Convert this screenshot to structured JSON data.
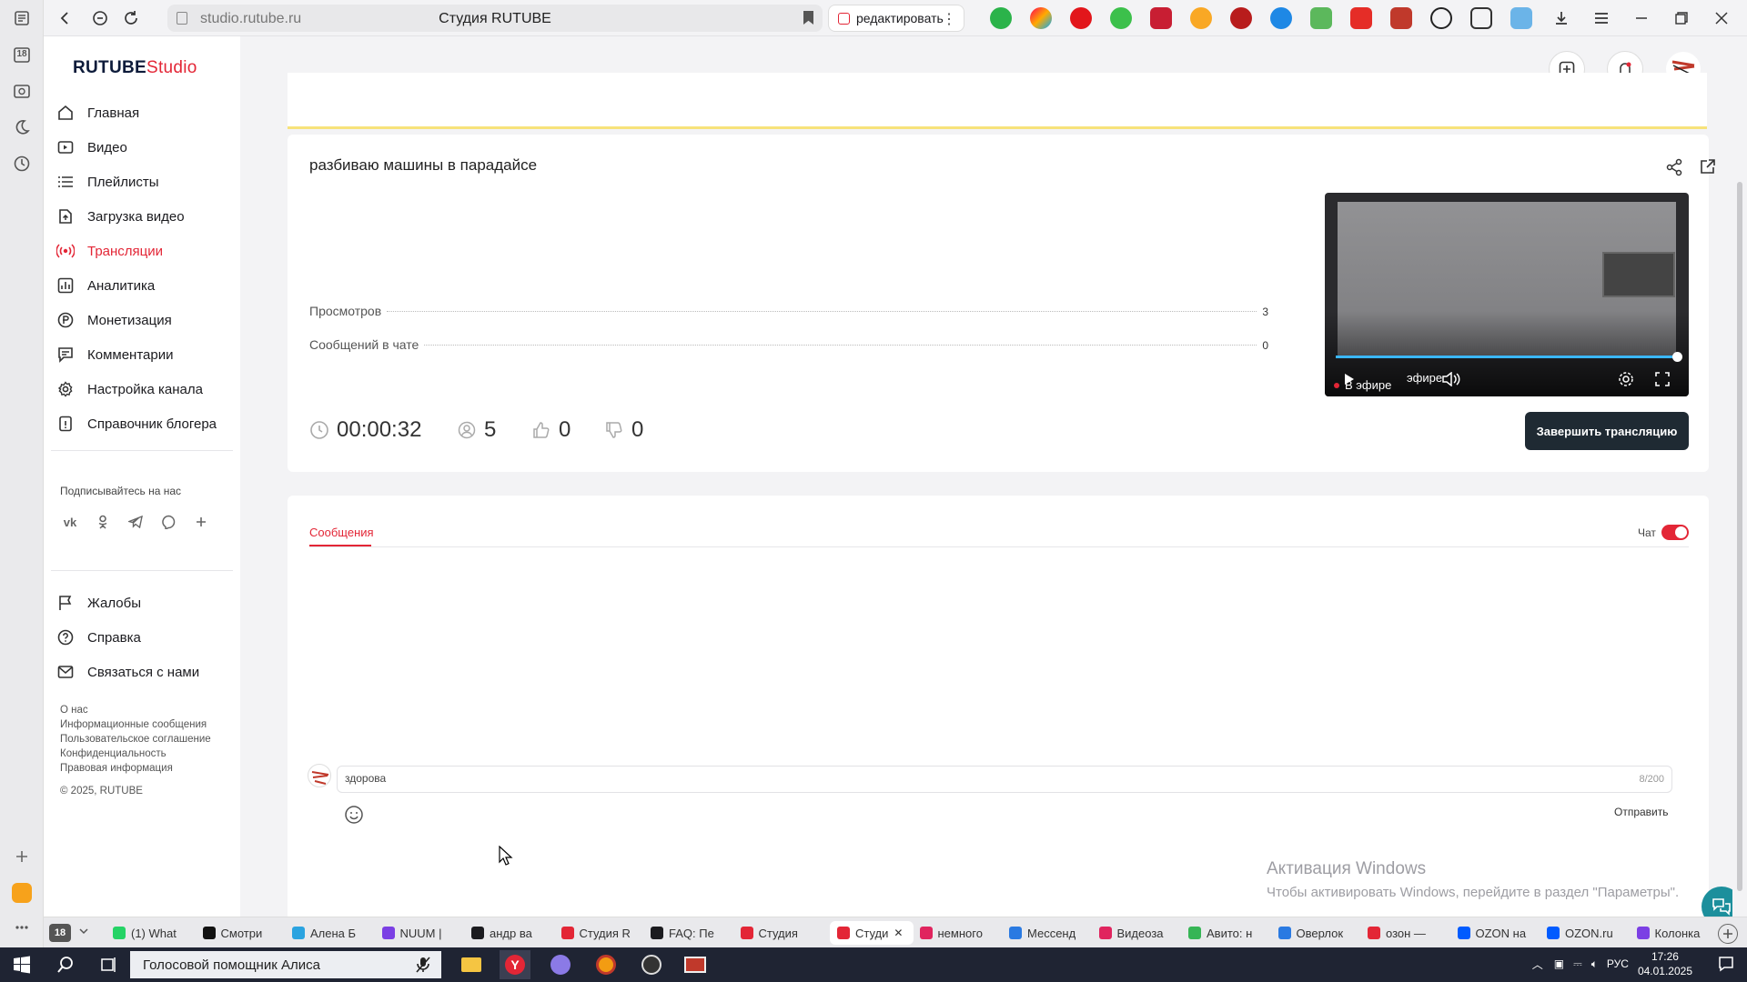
{
  "browser": {
    "url": "studio.rutube.ru",
    "tab_title": "Студия RUTUBE",
    "edit_button": "редактировать",
    "rail_badge": "18"
  },
  "logo": {
    "brand": "RUTUBE",
    "product": "Studio"
  },
  "sidebar": {
    "items": [
      {
        "label": "Главная",
        "icon": "home-icon"
      },
      {
        "label": "Видео",
        "icon": "video-icon"
      },
      {
        "label": "Плейлисты",
        "icon": "playlist-icon"
      },
      {
        "label": "Загрузка видео",
        "icon": "upload-icon"
      },
      {
        "label": "Трансляции",
        "icon": "broadcast-icon",
        "active": true
      },
      {
        "label": "Аналитика",
        "icon": "analytics-icon"
      },
      {
        "label": "Монетизация",
        "icon": "monetization-icon"
      },
      {
        "label": "Комментарии",
        "icon": "comments-icon"
      },
      {
        "label": "Настройка канала",
        "icon": "settings-icon"
      },
      {
        "label": "Справочник блогера",
        "icon": "guide-icon"
      }
    ],
    "follow_label": "Подписывайтесь на нас",
    "socials": [
      "vk-icon",
      "ok-icon",
      "telegram-icon",
      "viber-icon",
      "plus-icon"
    ],
    "secondary": [
      {
        "label": "Жалобы",
        "icon": "flag-icon"
      },
      {
        "label": "Справка",
        "icon": "help-icon"
      },
      {
        "label": "Связаться с нами",
        "icon": "mail-icon"
      }
    ],
    "footer_links": [
      "О нас",
      "Информационные сообщения",
      "Пользовательское соглашение",
      "Конфиденциальность",
      "Правовая информация"
    ],
    "copyright": "© 2025, RUTUBE"
  },
  "stream": {
    "title": "разбиваю машины в парадайсе",
    "stats": [
      {
        "label": "Просмотров",
        "value": "3"
      },
      {
        "label": "Сообщений в чате",
        "value": "0"
      }
    ],
    "duration": "00:00:32",
    "viewers": "5",
    "likes": "0",
    "dislikes": "0",
    "live_label": "В эфире",
    "live_label_partial": "эфире",
    "end_button": "Завершить трансляцию",
    "video_progress": 1.0
  },
  "chat": {
    "tab_label": "Сообщения",
    "toggle_label": "Чат",
    "toggle_on": true,
    "input_value": "здорова",
    "counter": "8/200",
    "send_label": "Отправить"
  },
  "windows_activation": {
    "title": "Активация Windows",
    "subtitle": "Чтобы активировать Windows, перейдите в раздел \"Параметры\"."
  },
  "tabs": [
    {
      "label": "(1) What",
      "color": "#25d366"
    },
    {
      "label": "Смотри",
      "color": "#111111"
    },
    {
      "label": "Алена Б",
      "color": "#2aa3e0"
    },
    {
      "label": "NUUM |",
      "color": "#7b3fe4"
    },
    {
      "label": "андр ва",
      "color": "#1b1b1f"
    },
    {
      "label": "Студия R",
      "color": "#e32636"
    },
    {
      "label": "FAQ: Пе",
      "color": "#1b1b1f"
    },
    {
      "label": "Студия",
      "color": "#e32636"
    },
    {
      "label": "Студи",
      "color": "#e32636",
      "active": true
    },
    {
      "label": "немного",
      "color": "#e0245e"
    },
    {
      "label": "Мессенд",
      "color": "#2a7ae2"
    },
    {
      "label": "Видеоза",
      "color": "#e0245e"
    },
    {
      "label": "Авито: н",
      "color": "#36b555"
    },
    {
      "label": "Оверлок",
      "color": "#2a7ae2"
    },
    {
      "label": "озон —",
      "color": "#e32636"
    },
    {
      "label": "OZON на",
      "color": "#005bff"
    },
    {
      "label": "OZON.ru",
      "color": "#005bff"
    },
    {
      "label": "Колонка",
      "color": "#7b3fe4"
    }
  ],
  "taskbar": {
    "alisa": "Голосовой помощник Алиса",
    "lang": "РУС",
    "time": "17:26",
    "date": "04.01.2025"
  }
}
